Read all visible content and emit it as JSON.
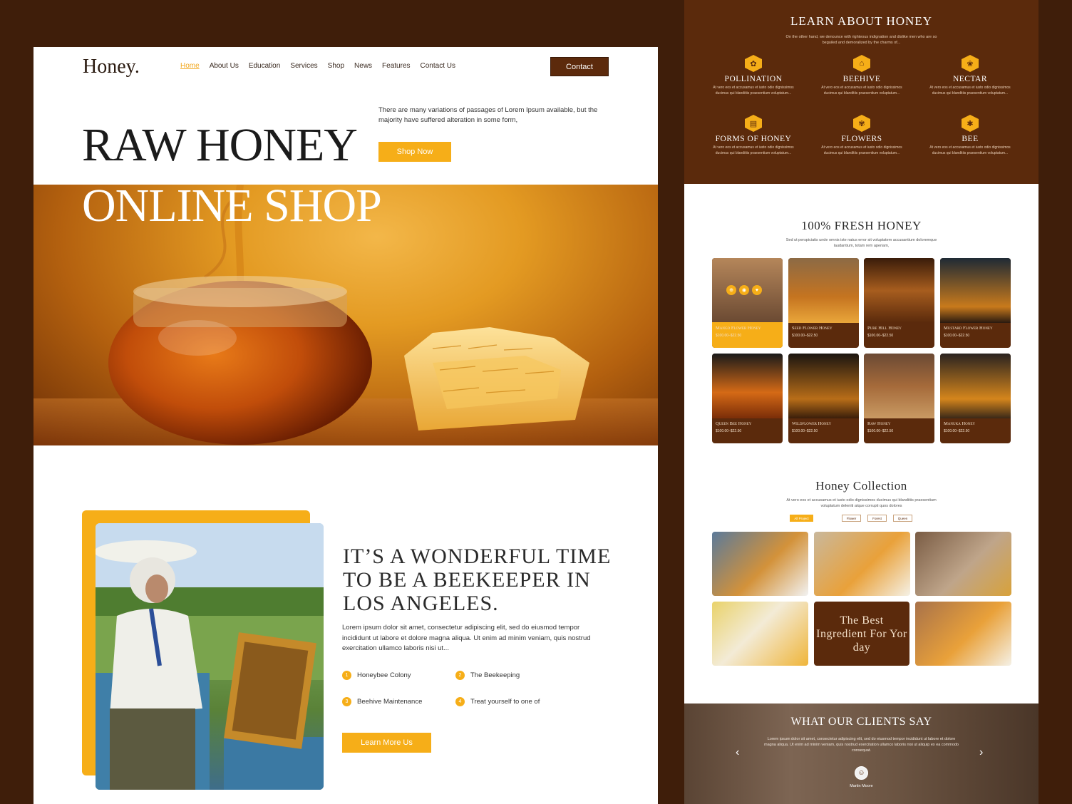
{
  "left": {
    "logo": "Honey.",
    "nav": [
      "Home",
      "About Us",
      "Education",
      "Services",
      "Shop",
      "News",
      "Features",
      "Contact Us"
    ],
    "contact_label": "Contact",
    "hero": {
      "title_line1": "RAW HONEY",
      "title_line2": "ONLINE SHOP",
      "description": "There are many variations of passages of Lorem Ipsum available, but the majority have suffered alteration in some form,",
      "shop_label": "Shop Now"
    },
    "about": {
      "title": "IT’S A WONDERFUL TIME TO BE A BEEKEEPER IN LOS ANGELES.",
      "text": "Lorem ipsum dolor sit amet, consectetur adipiscing elit, sed do eiusmod tempor incididunt ut labore et dolore magna aliqua. Ut enim ad minim veniam, quis nostrud exercitation ullamco laboris nisi ut...",
      "features": [
        {
          "num": "1",
          "label": "Honeybee Colony"
        },
        {
          "num": "2",
          "label": "The Beekeeping"
        },
        {
          "num": "3",
          "label": "Beehive Maintenance"
        },
        {
          "num": "4",
          "label": "Treat yourself to one of"
        }
      ],
      "learn_label": "Learn More Us"
    }
  },
  "right": {
    "learn": {
      "title": "LEARN ABOUT HONEY",
      "subtitle": "On the other hand, we denounce with righteous indignation and dislike men who are so beguiled and demoralized by the charms of...",
      "topics": [
        {
          "title": "POLLINATION",
          "icon": "flower-icon"
        },
        {
          "title": "BEEHIVE",
          "icon": "beehive-icon"
        },
        {
          "title": "NECTAR",
          "icon": "nectar-icon"
        },
        {
          "title": "FORMS OF HONEY",
          "icon": "honey-jar-icon"
        },
        {
          "title": "FLOWERS",
          "icon": "flowers-icon"
        },
        {
          "title": "BEE",
          "icon": "bee-icon"
        }
      ],
      "topic_desc": "At vero eos et accusamus et iusto odio dignissimos ducimus qui blanditiis praesentium voluptatum..."
    },
    "fresh": {
      "title": "100% FRESH HONEY",
      "subtitle": "Sed ut perspiciatis unde omnis iste natus error sit voluptatem accusantium doloremque laudantium, totam rem aperiam,",
      "products": [
        {
          "name": "Mango Flower Honey",
          "price": "$100.00–$22.50"
        },
        {
          "name": "Seed Flower Honey",
          "price": "$100.00–$22.50"
        },
        {
          "name": "Pure Hill Honey",
          "price": "$100.00–$22.50"
        },
        {
          "name": "Mustard Flower Honey",
          "price": "$100.00–$22.50"
        },
        {
          "name": "Queen Bee Honey",
          "price": "$100.00–$22.50"
        },
        {
          "name": "Wildflower Honey",
          "price": "$100.00–$22.50"
        },
        {
          "name": "Raw Honey",
          "price": "$100.00–$22.50"
        },
        {
          "name": "Manuka Honey",
          "price": "$100.00–$22.50"
        }
      ]
    },
    "collection": {
      "title": "Honey Collection",
      "subtitle": "At vero eos et accusamus et iusto odio dignissimos ducimus qui blanditiis praesentium voluptatum deleniti atque corrupti quos dolores",
      "filters": [
        "All Project",
        "Flower",
        "Forest",
        "Queen"
      ],
      "promo": "The Best Ingredient For Yor day"
    },
    "clients": {
      "title": "WHAT OUR CLIENTS SAY",
      "quote": "Lorem ipsum dolor sit amet, consectetur adipiscing elit, sed do eiusmod tempor incididunt ut labore et dolore magna aliqua. Ut enim ad minim veniam, quis nostrud exercitation ullamco laboris nisi ut aliquip ex ea commodo consequat.",
      "name": "Martin Moore"
    }
  },
  "colors": {
    "brown": "#5b2a0c",
    "yellow": "#f6ae18",
    "background": "#3f1e0a"
  }
}
